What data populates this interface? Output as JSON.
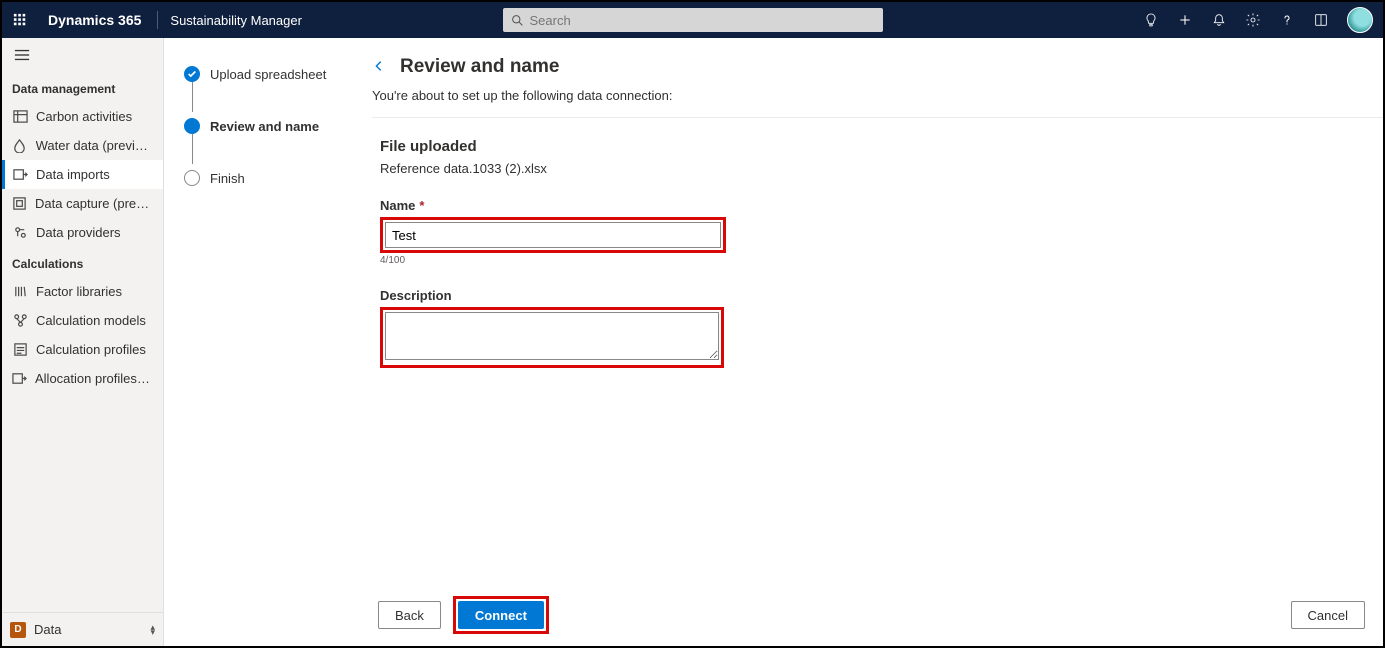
{
  "topbar": {
    "brand": "Dynamics 365",
    "module": "Sustainability Manager",
    "search_placeholder": "Search"
  },
  "sidebar": {
    "sections": [
      {
        "label": "Data management",
        "items": [
          {
            "label": "Carbon activities"
          },
          {
            "label": "Water data (preview)"
          },
          {
            "label": "Data imports"
          },
          {
            "label": "Data capture (preview)"
          },
          {
            "label": "Data providers"
          }
        ]
      },
      {
        "label": "Calculations",
        "items": [
          {
            "label": "Factor libraries"
          },
          {
            "label": "Calculation models"
          },
          {
            "label": "Calculation profiles"
          },
          {
            "label": "Allocation profiles (p..."
          }
        ]
      }
    ],
    "bottom": {
      "badge": "D",
      "label": "Data"
    }
  },
  "steps": [
    {
      "label": "Upload spreadsheet",
      "state": "done"
    },
    {
      "label": "Review and name",
      "state": "current"
    },
    {
      "label": "Finish",
      "state": "pending"
    }
  ],
  "main": {
    "title": "Review and name",
    "subtitle": "You're about to set up the following data connection:",
    "file_section_title": "File uploaded",
    "file_name": "Reference data.1033 (2).xlsx",
    "name_label": "Name",
    "name_value": "Test",
    "name_counter": "4/100",
    "description_label": "Description",
    "description_value": ""
  },
  "footer": {
    "back": "Back",
    "connect": "Connect",
    "cancel": "Cancel"
  }
}
